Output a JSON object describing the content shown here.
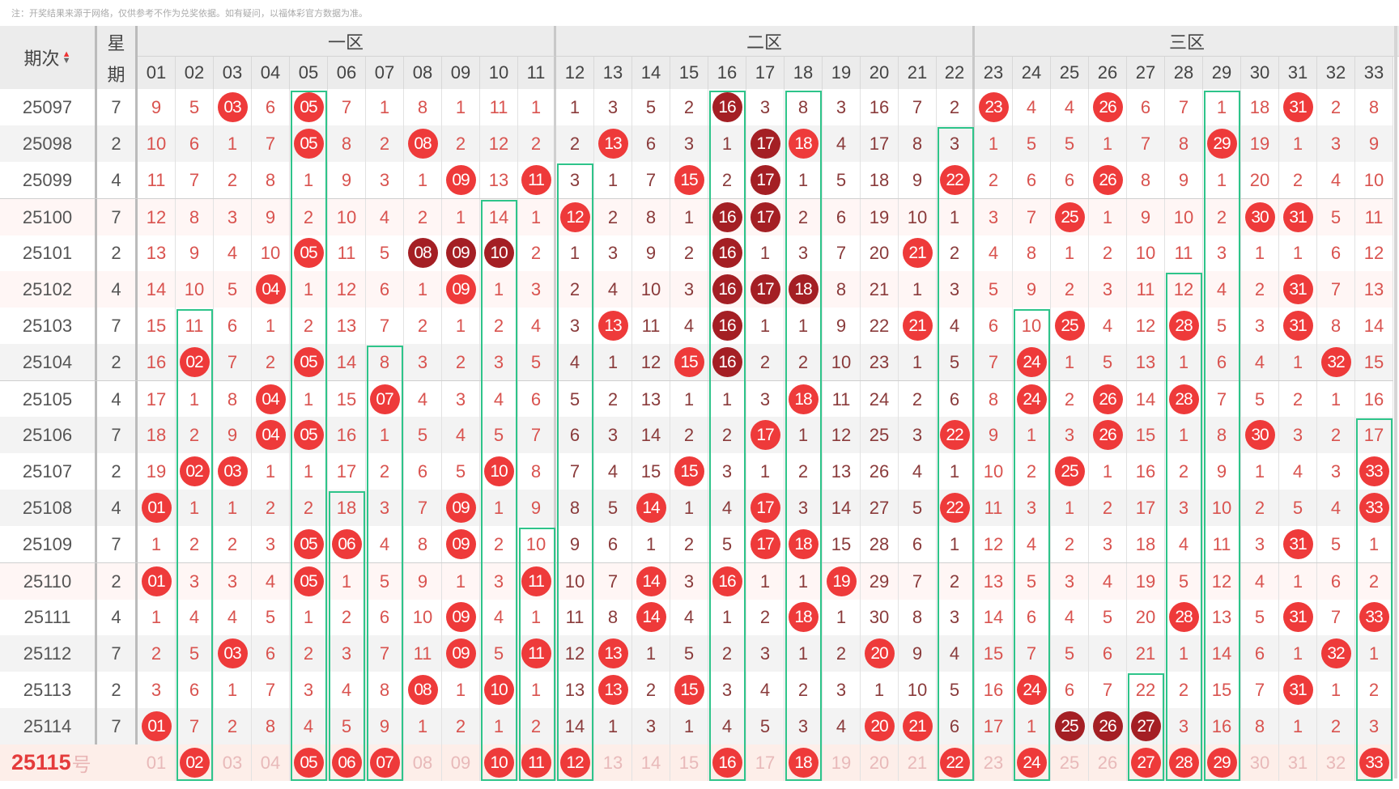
{
  "note": "注：开奖结果来源于网络，仅供参考不作为兑奖依据。如有疑问，以福体彩官方数据为准。",
  "header": {
    "period_label": "期次",
    "week_label_1": "星",
    "week_label_2": "期",
    "zones": [
      "一区",
      "二区",
      "三区"
    ],
    "columns": [
      "01",
      "02",
      "03",
      "04",
      "05",
      "06",
      "07",
      "08",
      "09",
      "10",
      "11",
      "12",
      "13",
      "14",
      "15",
      "16",
      "17",
      "18",
      "19",
      "20",
      "21",
      "22",
      "23",
      "24",
      "25",
      "26",
      "27",
      "28",
      "29",
      "30",
      "31",
      "32",
      "33"
    ]
  },
  "legend_note": "cells: '*' = drawn ball, '#' = consecutive (dark) ball",
  "colors": {
    "ball": "#ee3a3a",
    "ball_dark": "#a41f24",
    "streak_box": "#2ec48a"
  },
  "rows": [
    {
      "period": "25097",
      "week": "7",
      "cells": [
        "9",
        "5",
        "*03",
        "6",
        "*05",
        "7",
        "1",
        "8",
        "1",
        "11",
        "1",
        "1",
        "3",
        "5",
        "2",
        "#16",
        "3",
        "8",
        "3",
        "16",
        "7",
        "2",
        "*23",
        "4",
        "4",
        "*26",
        "6",
        "7",
        "1",
        "18",
        "*31",
        "2",
        "8"
      ]
    },
    {
      "period": "25098",
      "week": "2",
      "cells": [
        "10",
        "6",
        "1",
        "7",
        "*05",
        "8",
        "2",
        "*08",
        "2",
        "12",
        "2",
        "2",
        "*13",
        "6",
        "3",
        "1",
        "#17",
        "*18",
        "4",
        "17",
        "8",
        "3",
        "1",
        "5",
        "5",
        "1",
        "7",
        "8",
        "*29",
        "19",
        "1",
        "3",
        "9"
      ]
    },
    {
      "period": "25099",
      "week": "4",
      "cells": [
        "11",
        "7",
        "2",
        "8",
        "1",
        "9",
        "3",
        "1",
        "*09",
        "13",
        "*11",
        "3",
        "1",
        "7",
        "*15",
        "2",
        "#17",
        "1",
        "5",
        "18",
        "9",
        "*22",
        "2",
        "6",
        "6",
        "*26",
        "8",
        "9",
        "1",
        "20",
        "2",
        "4",
        "10"
      ]
    },
    {
      "period": "25100",
      "week": "7",
      "cells": [
        "12",
        "8",
        "3",
        "9",
        "2",
        "10",
        "4",
        "2",
        "1",
        "14",
        "1",
        "*12",
        "2",
        "8",
        "1",
        "#16",
        "#17",
        "2",
        "6",
        "19",
        "10",
        "1",
        "3",
        "7",
        "*25",
        "1",
        "9",
        "10",
        "2",
        "*30",
        "*31",
        "5",
        "11"
      ]
    },
    {
      "period": "25101",
      "week": "2",
      "cells": [
        "13",
        "9",
        "4",
        "10",
        "*05",
        "11",
        "5",
        "#08",
        "#09",
        "#10",
        "2",
        "1",
        "3",
        "9",
        "2",
        "#16",
        "1",
        "3",
        "7",
        "20",
        "*21",
        "2",
        "4",
        "8",
        "1",
        "2",
        "10",
        "11",
        "3",
        "1",
        "1",
        "6",
        "12"
      ]
    },
    {
      "period": "25102",
      "week": "4",
      "cells": [
        "14",
        "10",
        "5",
        "*04",
        "1",
        "12",
        "6",
        "1",
        "*09",
        "1",
        "3",
        "2",
        "4",
        "10",
        "3",
        "#16",
        "#17",
        "#18",
        "8",
        "21",
        "1",
        "3",
        "5",
        "9",
        "2",
        "3",
        "11",
        "12",
        "4",
        "2",
        "*31",
        "7",
        "13"
      ]
    },
    {
      "period": "25103",
      "week": "7",
      "cells": [
        "15",
        "11",
        "6",
        "1",
        "2",
        "13",
        "7",
        "2",
        "1",
        "2",
        "4",
        "3",
        "*13",
        "11",
        "4",
        "#16",
        "1",
        "1",
        "9",
        "22",
        "*21",
        "4",
        "6",
        "10",
        "*25",
        "4",
        "12",
        "*28",
        "5",
        "3",
        "*31",
        "8",
        "14"
      ]
    },
    {
      "period": "25104",
      "week": "2",
      "cells": [
        "16",
        "*02",
        "7",
        "2",
        "*05",
        "14",
        "8",
        "3",
        "2",
        "3",
        "5",
        "4",
        "1",
        "12",
        "*15",
        "#16",
        "2",
        "2",
        "10",
        "23",
        "1",
        "5",
        "7",
        "*24",
        "1",
        "5",
        "13",
        "1",
        "6",
        "4",
        "1",
        "*32",
        "15"
      ]
    },
    {
      "period": "25105",
      "week": "4",
      "cells": [
        "17",
        "1",
        "8",
        "*04",
        "1",
        "15",
        "*07",
        "4",
        "3",
        "4",
        "6",
        "5",
        "2",
        "13",
        "1",
        "1",
        "3",
        "*18",
        "11",
        "24",
        "2",
        "6",
        "8",
        "*24",
        "2",
        "*26",
        "14",
        "*28",
        "7",
        "5",
        "2",
        "1",
        "16"
      ]
    },
    {
      "period": "25106",
      "week": "7",
      "cells": [
        "18",
        "2",
        "9",
        "*04",
        "*05",
        "16",
        "1",
        "5",
        "4",
        "5",
        "7",
        "6",
        "3",
        "14",
        "2",
        "2",
        "*17",
        "1",
        "12",
        "25",
        "3",
        "*22",
        "9",
        "1",
        "3",
        "*26",
        "15",
        "1",
        "8",
        "*30",
        "3",
        "2",
        "17"
      ]
    },
    {
      "period": "25107",
      "week": "2",
      "cells": [
        "19",
        "*02",
        "*03",
        "1",
        "1",
        "17",
        "2",
        "6",
        "5",
        "*10",
        "8",
        "7",
        "4",
        "15",
        "*15",
        "3",
        "1",
        "2",
        "13",
        "26",
        "4",
        "1",
        "10",
        "2",
        "*25",
        "1",
        "16",
        "2",
        "9",
        "1",
        "4",
        "3",
        "*33"
      ]
    },
    {
      "period": "25108",
      "week": "4",
      "cells": [
        "*01",
        "1",
        "1",
        "2",
        "2",
        "18",
        "3",
        "7",
        "*09",
        "1",
        "9",
        "8",
        "5",
        "*14",
        "1",
        "4",
        "*17",
        "3",
        "14",
        "27",
        "5",
        "*22",
        "11",
        "3",
        "1",
        "2",
        "17",
        "3",
        "10",
        "2",
        "5",
        "4",
        "*33"
      ]
    },
    {
      "period": "25109",
      "week": "7",
      "cells": [
        "1",
        "2",
        "2",
        "3",
        "*05",
        "*06",
        "4",
        "8",
        "*09",
        "2",
        "10",
        "9",
        "6",
        "1",
        "2",
        "5",
        "*17",
        "*18",
        "15",
        "28",
        "6",
        "1",
        "12",
        "4",
        "2",
        "3",
        "18",
        "4",
        "11",
        "3",
        "*31",
        "5",
        "1"
      ]
    },
    {
      "period": "25110",
      "week": "2",
      "cells": [
        "*01",
        "3",
        "3",
        "4",
        "*05",
        "1",
        "5",
        "9",
        "1",
        "3",
        "*11",
        "10",
        "7",
        "*14",
        "3",
        "*16",
        "1",
        "1",
        "*19",
        "29",
        "7",
        "2",
        "13",
        "5",
        "3",
        "4",
        "19",
        "5",
        "12",
        "4",
        "1",
        "6",
        "2"
      ]
    },
    {
      "period": "25111",
      "week": "4",
      "cells": [
        "1",
        "4",
        "4",
        "5",
        "1",
        "2",
        "6",
        "10",
        "*09",
        "4",
        "1",
        "11",
        "8",
        "*14",
        "4",
        "1",
        "2",
        "*18",
        "1",
        "30",
        "8",
        "3",
        "14",
        "6",
        "4",
        "5",
        "20",
        "*28",
        "13",
        "5",
        "*31",
        "7",
        "*33"
      ]
    },
    {
      "period": "25112",
      "week": "7",
      "cells": [
        "2",
        "5",
        "*03",
        "6",
        "2",
        "3",
        "7",
        "11",
        "*09",
        "5",
        "*11",
        "12",
        "*13",
        "1",
        "5",
        "2",
        "3",
        "1",
        "2",
        "*20",
        "9",
        "4",
        "15",
        "7",
        "5",
        "6",
        "21",
        "1",
        "14",
        "6",
        "1",
        "*32",
        "1"
      ]
    },
    {
      "period": "25113",
      "week": "2",
      "cells": [
        "3",
        "6",
        "1",
        "7",
        "3",
        "4",
        "8",
        "*08",
        "1",
        "*10",
        "1",
        "13",
        "*13",
        "2",
        "*15",
        "3",
        "4",
        "2",
        "3",
        "1",
        "10",
        "5",
        "16",
        "*24",
        "6",
        "7",
        "22",
        "2",
        "15",
        "7",
        "*31",
        "1",
        "2"
      ]
    },
    {
      "period": "25114",
      "week": "7",
      "cells": [
        "*01",
        "7",
        "2",
        "8",
        "4",
        "5",
        "9",
        "1",
        "2",
        "1",
        "2",
        "14",
        "1",
        "3",
        "1",
        "4",
        "5",
        "3",
        "4",
        "*20",
        "*21",
        "6",
        "17",
        "1",
        "#25",
        "#26",
        "#27",
        "3",
        "16",
        "8",
        "1",
        "2",
        "3"
      ]
    }
  ],
  "forecast": {
    "period": "25115",
    "suffix": "号",
    "cells": [
      "01",
      "*02",
      "03",
      "04",
      "*05",
      "*06",
      "*07",
      "08",
      "09",
      "*10",
      "*11",
      "*12",
      "13",
      "14",
      "15",
      "*16",
      "17",
      "*18",
      "19",
      "20",
      "21",
      "*22",
      "23",
      "*24",
      "25",
      "26",
      "*27",
      "*28",
      "*29",
      "30",
      "31",
      "32",
      "*33"
    ]
  }
}
